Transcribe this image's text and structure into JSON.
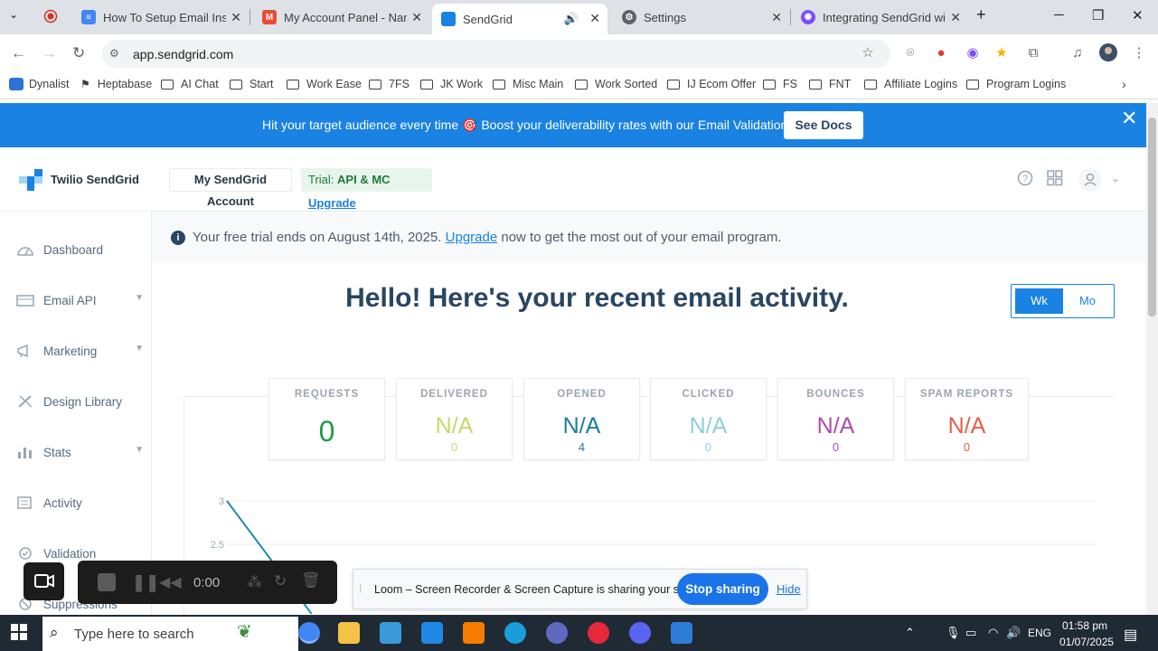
{
  "browser": {
    "tabs": [
      {
        "title": "How To Setup Email Inside",
        "icon": "docs-icon",
        "color": "#4285f4"
      },
      {
        "title": "My Account Panel - Name",
        "icon": "app-icon",
        "color": "#e94b35"
      },
      {
        "title": "SendGrid",
        "icon": "sendgrid-icon",
        "color": "#1a82e2",
        "active": true
      },
      {
        "title": "Settings",
        "icon": "settings-icon",
        "color": "#5f6368"
      },
      {
        "title": "Integrating SendGrid with",
        "icon": "sparkle-icon",
        "color": "#7c4dff"
      }
    ],
    "url": "app.sendgrid.com"
  },
  "bookmarks": [
    {
      "label": "Dynalist",
      "type": "site"
    },
    {
      "label": "Heptabase",
      "type": "site"
    },
    {
      "label": "AI Chat",
      "type": "folder"
    },
    {
      "label": "Start",
      "type": "folder"
    },
    {
      "label": "Work Ease",
      "type": "folder"
    },
    {
      "label": "7FS",
      "type": "folder"
    },
    {
      "label": "JK Work",
      "type": "folder"
    },
    {
      "label": "Misc Main",
      "type": "folder"
    },
    {
      "label": "Work Sorted",
      "type": "folder"
    },
    {
      "label": "IJ Ecom Offer",
      "type": "folder"
    },
    {
      "label": "FS",
      "type": "folder"
    },
    {
      "label": "FNT",
      "type": "folder"
    },
    {
      "label": "Affiliate Logins",
      "type": "folder"
    },
    {
      "label": "Program Logins",
      "type": "folder"
    }
  ],
  "promo": {
    "text": "Hit your target audience every time 🎯 Boost your deliverability rates with our Email Validation APIs.",
    "button": "See Docs"
  },
  "header": {
    "logo": "Twilio SendGrid",
    "account_button": "My SendGrid Account",
    "trial_label": "Trial: ",
    "trial_plan": "API & MC",
    "upgrade": "Upgrade"
  },
  "sidebar": {
    "items": [
      {
        "label": "Dashboard",
        "icon": "dashboard-icon",
        "has_children": false
      },
      {
        "label": "Email API",
        "icon": "email-icon",
        "has_children": true
      },
      {
        "label": "Marketing",
        "icon": "megaphone-icon",
        "has_children": true
      },
      {
        "label": "Design Library",
        "icon": "brush-icon",
        "has_children": false
      },
      {
        "label": "Stats",
        "icon": "bar-chart-icon",
        "has_children": true
      },
      {
        "label": "Activity",
        "icon": "activity-icon",
        "has_children": false
      },
      {
        "label": "Validation",
        "icon": "validation-icon",
        "has_children": false
      },
      {
        "label": "Suppressions",
        "icon": "suppressions-icon",
        "has_children": false
      }
    ]
  },
  "trial_notice": {
    "pre": "Your free trial ends on August 14th, 2025. ",
    "link": "Upgrade",
    "post": " now to get the most out of your email program."
  },
  "main": {
    "heading": "Hello! Here's your recent email activity.",
    "toggle": {
      "week": "Wk",
      "month": "Mo",
      "selected": "Wk"
    }
  },
  "stats": [
    {
      "label": "REQUESTS",
      "value": "0",
      "sub": "",
      "color": "#1f9b4a"
    },
    {
      "label": "DELIVERED",
      "value": "N/A",
      "sub": "0",
      "color": "#c5d96b"
    },
    {
      "label": "OPENED",
      "value": "N/A",
      "sub": "4",
      "color": "#1b7f99"
    },
    {
      "label": "CLICKED",
      "value": "N/A",
      "sub": "0",
      "color": "#8fcde0"
    },
    {
      "label": "BOUNCES",
      "value": "N/A",
      "sub": "0",
      "color": "#b04caa"
    },
    {
      "label": "SPAM REPORTS",
      "value": "N/A",
      "sub": "0",
      "color": "#e0604a"
    }
  ],
  "chart_data": {
    "type": "line",
    "ytick_labels": [
      "3",
      "2.5"
    ],
    "ylim": [
      2.5,
      3
    ],
    "series": [
      {
        "values": [
          3,
          2.5
        ]
      }
    ],
    "grid": true
  },
  "loom": {
    "timer": "0:00",
    "share_text": "Loom – Screen Recorder & Screen Capture is sharing your screen.",
    "stop_button": "Stop sharing",
    "hide_button": "Hide"
  },
  "taskbar": {
    "search_placeholder": "Type here to search",
    "language": "ENG",
    "time": "01:58 pm",
    "date": "01/07/2025"
  }
}
